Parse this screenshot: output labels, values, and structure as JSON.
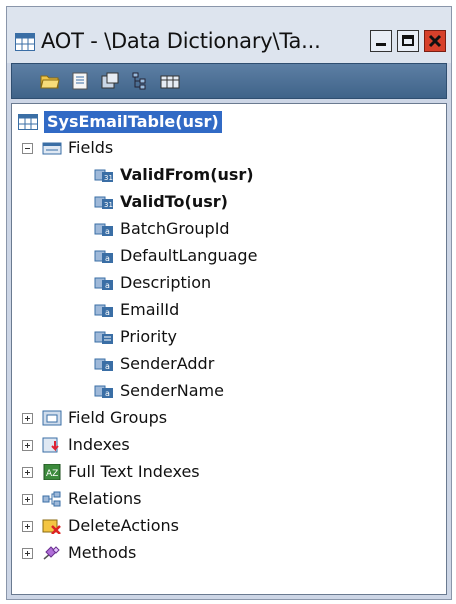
{
  "window": {
    "title": "AOT - \\Data Dictionary\\Ta...",
    "controls": {
      "minimize": "minimize",
      "maximize": "maximize",
      "close": "close"
    }
  },
  "toolbar": {
    "buttons": [
      "open-icon",
      "properties-icon",
      "compile-icon",
      "tree-icon",
      "grid-icon"
    ]
  },
  "tree": {
    "root": {
      "label": "SysEmailTable(usr)",
      "selected": true
    },
    "fields_label": "Fields",
    "fields": [
      {
        "label": "ValidFrom(usr)",
        "bold": true
      },
      {
        "label": "ValidTo(usr)",
        "bold": true
      },
      {
        "label": "BatchGroupId",
        "bold": false
      },
      {
        "label": "DefaultLanguage",
        "bold": false
      },
      {
        "label": "Description",
        "bold": false
      },
      {
        "label": "EmailId",
        "bold": false
      },
      {
        "label": "Priority",
        "bold": false
      },
      {
        "label": "SenderAddr",
        "bold": false
      },
      {
        "label": "SenderName",
        "bold": false
      }
    ],
    "nodes": [
      {
        "label": "Field Groups",
        "icon": "field-groups-icon"
      },
      {
        "label": "Indexes",
        "icon": "indexes-icon"
      },
      {
        "label": "Full Text Indexes",
        "icon": "full-text-indexes-icon"
      },
      {
        "label": "Relations",
        "icon": "relations-icon"
      },
      {
        "label": "DeleteActions",
        "icon": "delete-actions-icon"
      },
      {
        "label": "Methods",
        "icon": "methods-icon"
      }
    ]
  },
  "colors": {
    "selection": "#316ac5",
    "toolbar": "#4a6e93",
    "close_button": "#d7402b"
  }
}
